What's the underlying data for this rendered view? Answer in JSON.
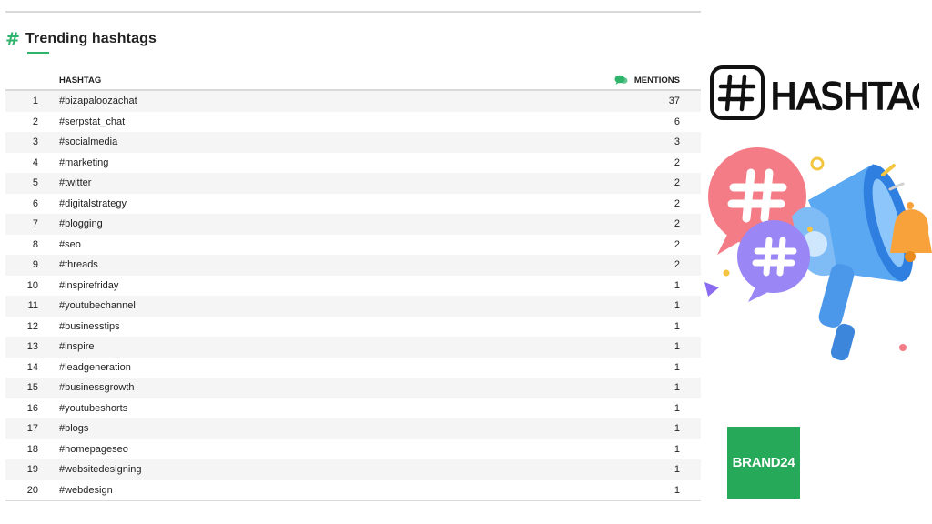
{
  "panel": {
    "title": "Trending hashtags",
    "icon": "hash-icon",
    "accent_color": "#2fb36b"
  },
  "table": {
    "columns": {
      "hashtag": "HASHTAG",
      "mentions": "MENTIONS"
    },
    "rows": [
      {
        "rank": "1",
        "tag": "#bizapaloozachat",
        "mentions": "37"
      },
      {
        "rank": "2",
        "tag": "#serpstat_chat",
        "mentions": "6"
      },
      {
        "rank": "3",
        "tag": "#socialmedia",
        "mentions": "3"
      },
      {
        "rank": "4",
        "tag": "#marketing",
        "mentions": "2"
      },
      {
        "rank": "5",
        "tag": "#twitter",
        "mentions": "2"
      },
      {
        "rank": "6",
        "tag": "#digitalstrategy",
        "mentions": "2"
      },
      {
        "rank": "7",
        "tag": "#blogging",
        "mentions": "2"
      },
      {
        "rank": "8",
        "tag": "#seo",
        "mentions": "2"
      },
      {
        "rank": "9",
        "tag": "#threads",
        "mentions": "2"
      },
      {
        "rank": "10",
        "tag": "#inspirefriday",
        "mentions": "1"
      },
      {
        "rank": "11",
        "tag": "#youtubechannel",
        "mentions": "1"
      },
      {
        "rank": "12",
        "tag": "#businesstips",
        "mentions": "1"
      },
      {
        "rank": "13",
        "tag": "#inspire",
        "mentions": "1"
      },
      {
        "rank": "14",
        "tag": "#leadgeneration",
        "mentions": "1"
      },
      {
        "rank": "15",
        "tag": "#businessgrowth",
        "mentions": "1"
      },
      {
        "rank": "16",
        "tag": "#youtubeshorts",
        "mentions": "1"
      },
      {
        "rank": "17",
        "tag": "#blogs",
        "mentions": "1"
      },
      {
        "rank": "18",
        "tag": "#homepageseo",
        "mentions": "1"
      },
      {
        "rank": "19",
        "tag": "#websitedesigning",
        "mentions": "1"
      },
      {
        "rank": "20",
        "tag": "#webdesign",
        "mentions": "1"
      }
    ]
  },
  "art": {
    "hashtag_word": "HASHTAG",
    "brand_label": "BRAND24",
    "brand_color": "#27a95a"
  }
}
